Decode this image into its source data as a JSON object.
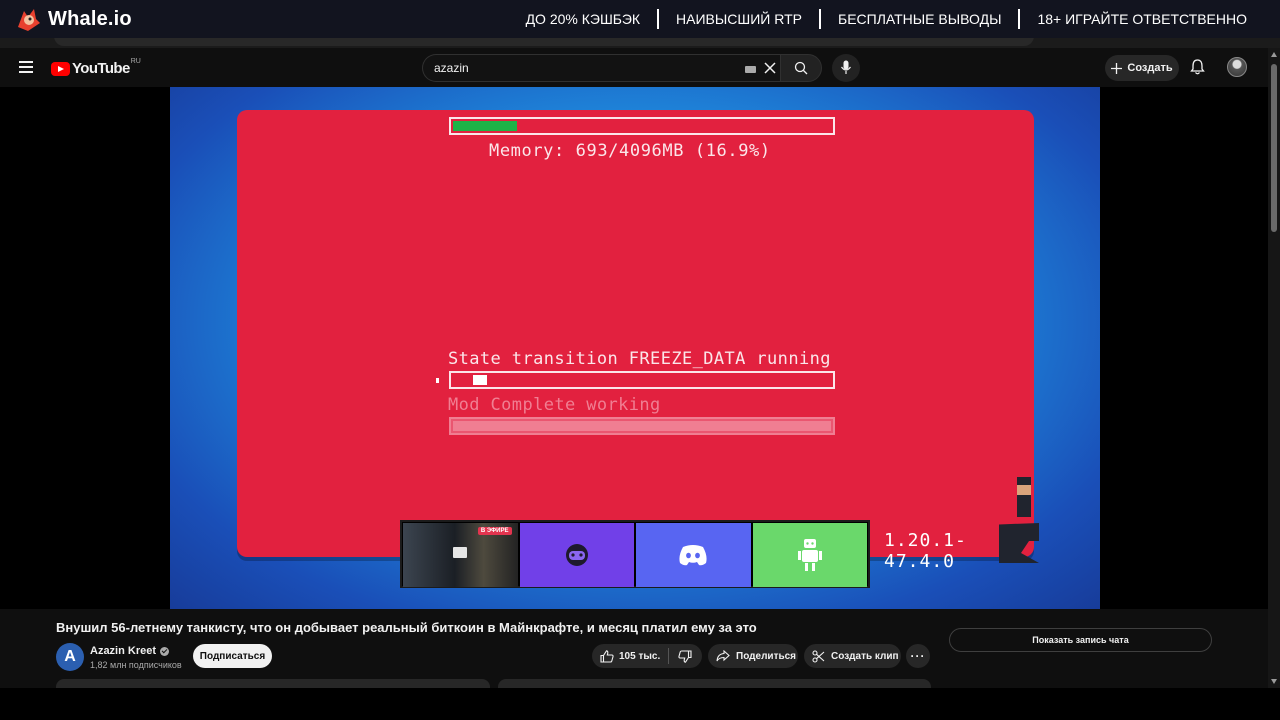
{
  "promo": {
    "brand": "Whale.io",
    "items": [
      "ДО 20% КЭШБЭК",
      "НАИВЫСШИЙ RTP",
      "БЕСПЛАТНЫЕ ВЫВОДЫ",
      "18+ ИГРАЙТЕ ОТВЕТСТВЕННО"
    ]
  },
  "header": {
    "logo_text": "YouTube",
    "region": "RU",
    "search_value": "azazin",
    "create_label": "Создать"
  },
  "video": {
    "memory_text": "Memory: 693/4096MB (16.9%)",
    "memory_fraction": 0.169,
    "state_text": "State transition FREEZE_DATA running",
    "mod_text": "Mod Complete working",
    "version": "1.20.1-47.4.0",
    "live_badge": "В ЭФИРЕ"
  },
  "info": {
    "title": "Внушил 56-летнему танкисту, что он добывает реальный биткоин в Майнкрафте, и месяц платил ему за это",
    "channel_name": "Azazin Kreet",
    "channel_initial": "A",
    "subscribers": "1,82 млн подписчиков",
    "subscribe_label": "Подписаться",
    "likes": "105 тыс.",
    "share_label": "Поделиться",
    "clip_label": "Создать клип",
    "more_label": "···",
    "chat_label": "Показать запись чата"
  },
  "colors": {
    "youtube_red": "#ff0000",
    "forge_red": "#e2213f",
    "memory_green": "#1db347"
  }
}
